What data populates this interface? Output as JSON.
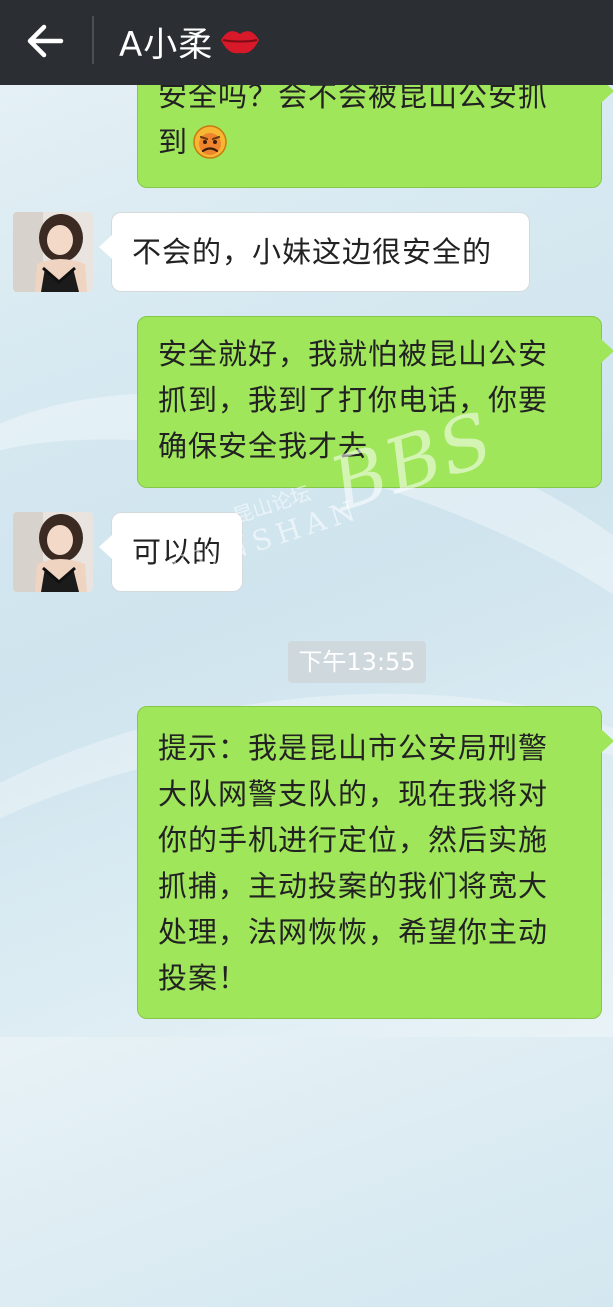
{
  "header": {
    "title": "A小柔",
    "back_icon": "arrow-left-icon",
    "title_emoji": "lips-icon",
    "colors": {
      "bar": "#2b2f33",
      "text": "#ffffff"
    }
  },
  "messages": [
    {
      "side": "out",
      "line1": "安全吗？会不会被昆山公安抓",
      "line2": "到",
      "emoji": "worried-face-icon"
    },
    {
      "side": "in",
      "text": "不会的，小妹这边很安全的"
    },
    {
      "side": "out",
      "lines": [
        "安全就好，我就怕被昆山公安",
        "抓到，我到了打你电话，你要",
        "确保安全我才去"
      ]
    },
    {
      "side": "in",
      "text": "可以的"
    },
    {
      "side": "out",
      "lines": [
        "提示：我是昆山市公安局刑警",
        "大队网警支队的，现在我将对",
        "你的手机进行定位，然后实施",
        "抓捕，主动投案的我们将宽大",
        "处理，法网恢恢，希望你主动",
        "投案！"
      ]
    }
  ],
  "timestamp": "下午13:55",
  "watermark": {
    "cn": "昆山论坛",
    "en": "KUNSHAN",
    "big": "BBS"
  },
  "colors": {
    "outgoing_bubble": "#9fe65a",
    "incoming_bubble": "#ffffff"
  }
}
